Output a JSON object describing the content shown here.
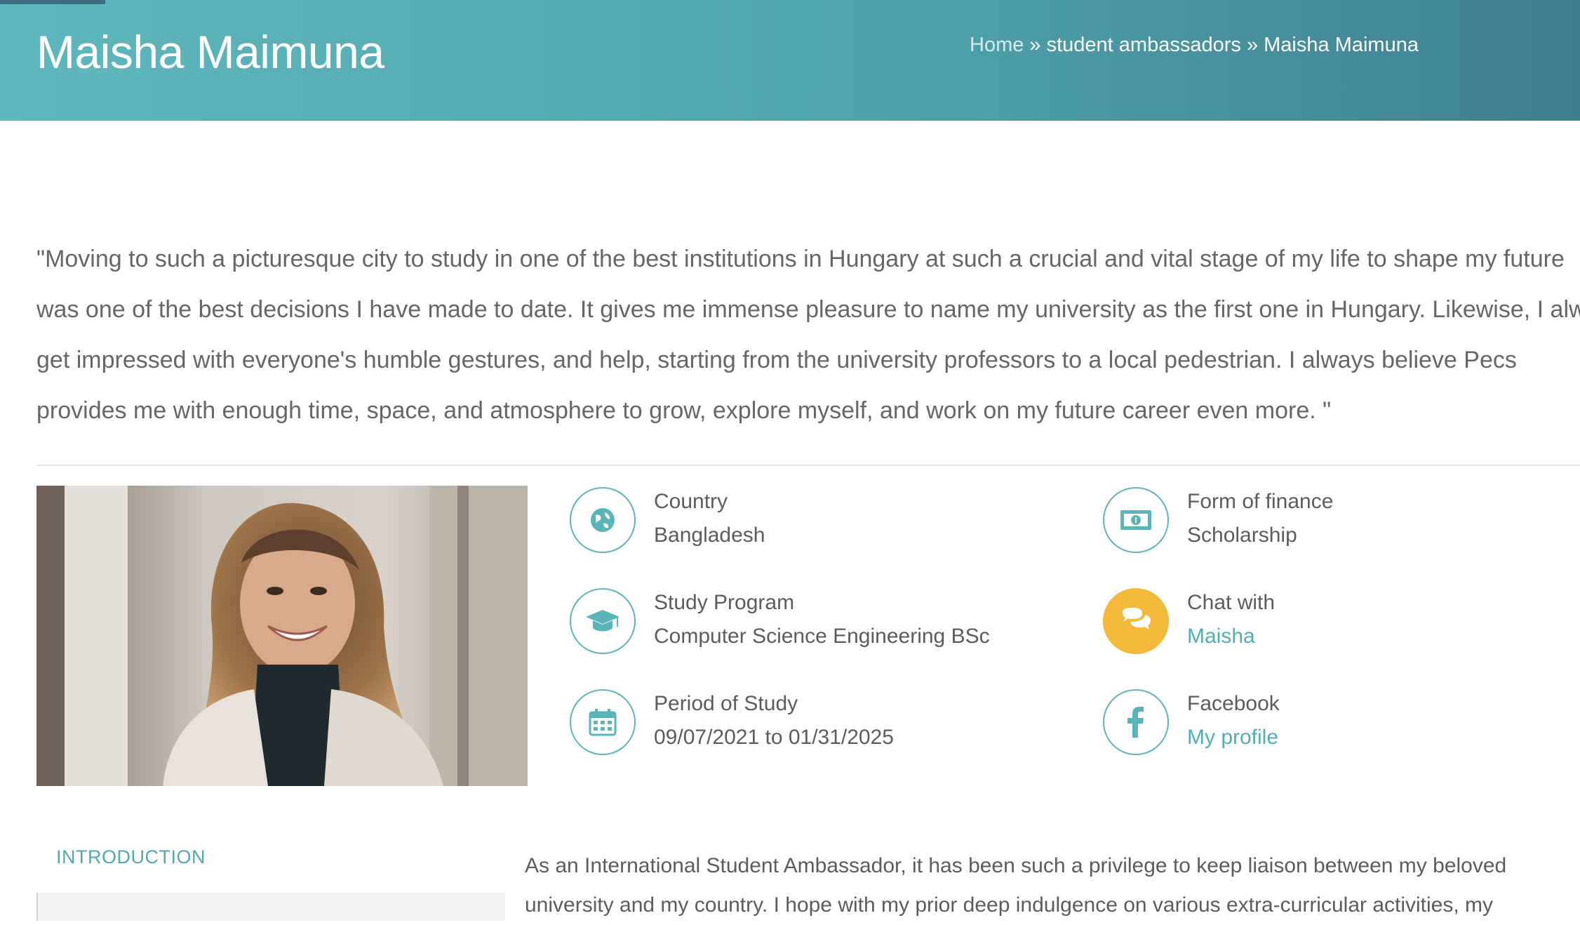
{
  "header": {
    "title": "Maisha Maimuna",
    "breadcrumb": {
      "home": "Home",
      "sep1": " » ",
      "section": "student ambassadors",
      "sep2": " » ",
      "current": "Maisha Maimuna"
    },
    "colors": {
      "gradient_start": "#5fb8bd",
      "gradient_end": "#3e7f8f"
    }
  },
  "quote": {
    "lines": [
      "\"Moving to such a picturesque city to study in one of the best institutions in Hungary at such a crucial and vital stage of my life to shape my future",
      "was one of the best decisions I have made to date. It gives me immense pleasure to name my university as the first one in Hungary. Likewise, I always",
      "get impressed with everyone's humble gestures, and help, starting from the university professors to a local pedestrian. I always believe Pecs",
      "provides me with enough time, space, and atmosphere to grow, explore myself, and work on my future career even more. \""
    ]
  },
  "info": {
    "country": {
      "label": "Country",
      "value": "Bangladesh",
      "icon": "globe-icon"
    },
    "program": {
      "label": "Study Program",
      "value": "Computer Science Engineering BSc",
      "icon": "graduation-cap-icon"
    },
    "period": {
      "label": "Period of Study",
      "value": "09/07/2021 to 01/31/2025",
      "icon": "calendar-icon"
    },
    "finance": {
      "label": "Form of finance",
      "value": "Scholarship",
      "icon": "banknote-icon"
    },
    "chat": {
      "label": "Chat with",
      "value": "Maisha",
      "icon": "chat-bubbles-icon"
    },
    "facebook": {
      "label": "Facebook",
      "value": "My profile",
      "icon": "facebook-icon"
    }
  },
  "accent_colors": {
    "teal": "#5ab5b8",
    "link": "#4fb0b4",
    "chat": "#f2b93a"
  },
  "intro": {
    "tab_label": "INTRODUCTION",
    "lines": [
      "As an International Student Ambassador, it has been such a privilege to keep liaison between my beloved",
      "university and my country. I hope with my prior deep indulgence on various extra-curricular activities, my"
    ]
  }
}
